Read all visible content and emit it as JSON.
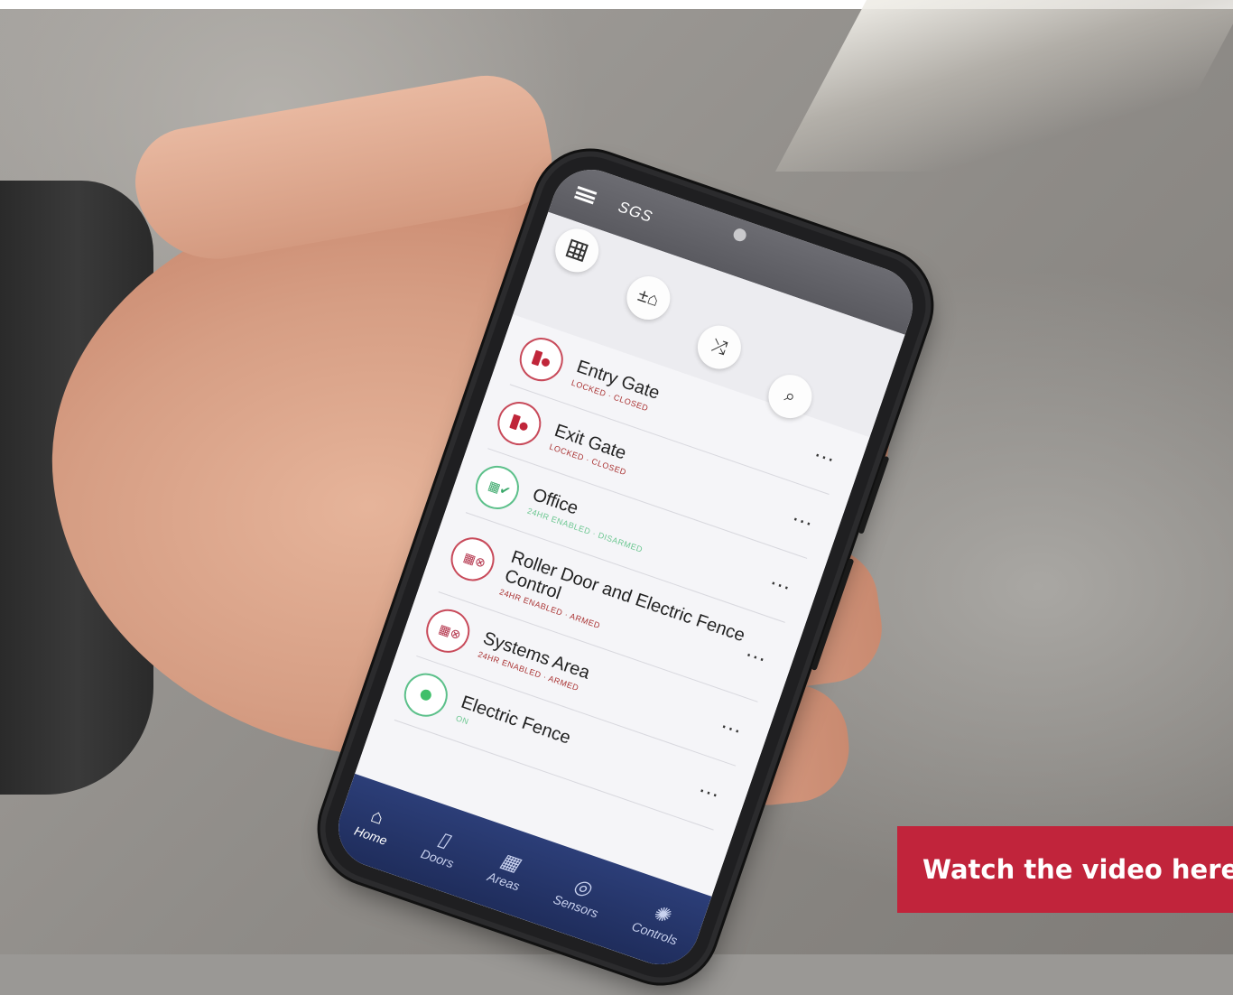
{
  "app": {
    "title": "SGS"
  },
  "toolbar": [
    {
      "icon": "grid-icon",
      "glyph": ""
    },
    {
      "icon": "home-plus-minus-icon",
      "glyph": "±⌂"
    },
    {
      "icon": "shuffle-icon",
      "glyph": "⤮"
    },
    {
      "icon": "search-icon",
      "glyph": "⌕"
    }
  ],
  "list": [
    {
      "name": "Entry Gate",
      "status": "LOCKED · CLOSED",
      "icon": "door-icon",
      "tone": "red"
    },
    {
      "name": "Exit Gate",
      "status": "LOCKED · CLOSED",
      "icon": "door-icon",
      "tone": "red"
    },
    {
      "name": "Office",
      "status": "24HR ENABLED · DISARMED",
      "icon": "area-shield-icon",
      "tone": "green"
    },
    {
      "name": "Roller Door and Electric Fence Control",
      "status": "24HR ENABLED · ARMED",
      "icon": "area-alarm-icon",
      "tone": "red"
    },
    {
      "name": "Systems Area",
      "status": "24HR ENABLED · ARMED",
      "icon": "area-alarm-icon",
      "tone": "red"
    },
    {
      "name": "Electric Fence",
      "status": "ON",
      "icon": "control-icon",
      "tone": "green"
    }
  ],
  "more_glyph": "...",
  "tabs": [
    {
      "label": "Home",
      "icon": "home-icon",
      "glyph": "⌂",
      "active": true
    },
    {
      "label": "Doors",
      "icon": "door-icon",
      "glyph": "▯",
      "active": false
    },
    {
      "label": "Areas",
      "icon": "areas-icon",
      "glyph": "▦",
      "active": false
    },
    {
      "label": "Sensors",
      "icon": "sensor-icon",
      "glyph": "◎",
      "active": false
    },
    {
      "label": "Controls",
      "icon": "controls-icon",
      "glyph": "✺",
      "active": false
    }
  ],
  "cta": {
    "label": "Watch the video here"
  },
  "colors": {
    "accent": "#c1243b",
    "armed": "#c0263a",
    "disarmed": "#3fbf6a",
    "tabbar": "#2c3e78"
  }
}
